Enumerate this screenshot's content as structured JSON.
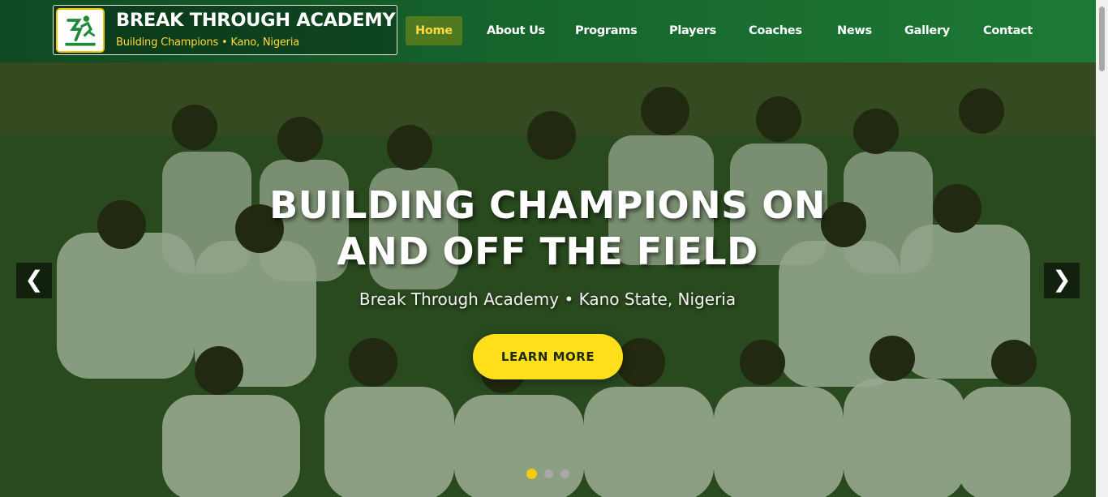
{
  "brand": {
    "title": "BREAK THROUGH ACADEMY",
    "tagline": "Building Champions • Kano, Nigeria",
    "logo_icon": "runner-logo-icon"
  },
  "nav": {
    "items": [
      {
        "label": "Home",
        "active": true
      },
      {
        "label": "About Us",
        "active": false
      },
      {
        "label": "Programs",
        "active": false
      },
      {
        "label": "Players",
        "active": false
      },
      {
        "label": "Coaches",
        "active": false
      },
      {
        "label": "News",
        "active": false
      },
      {
        "label": "Gallery",
        "active": false
      },
      {
        "label": "Contact",
        "active": false
      }
    ]
  },
  "hero": {
    "title_line1": "BUILDING CHAMPIONS ON",
    "title_line2": "AND OFF THE FIELD",
    "subtitle": "Break Through Academy • Kano State, Nigeria",
    "cta_label": "LEARN MORE",
    "prev_label": "❮",
    "next_label": "❯",
    "slide_count": 3,
    "active_slide": 1
  },
  "colors": {
    "header_green": "#16632c",
    "accent_yellow": "#ffe01a",
    "active_nav_bg": "#4f7a20"
  }
}
